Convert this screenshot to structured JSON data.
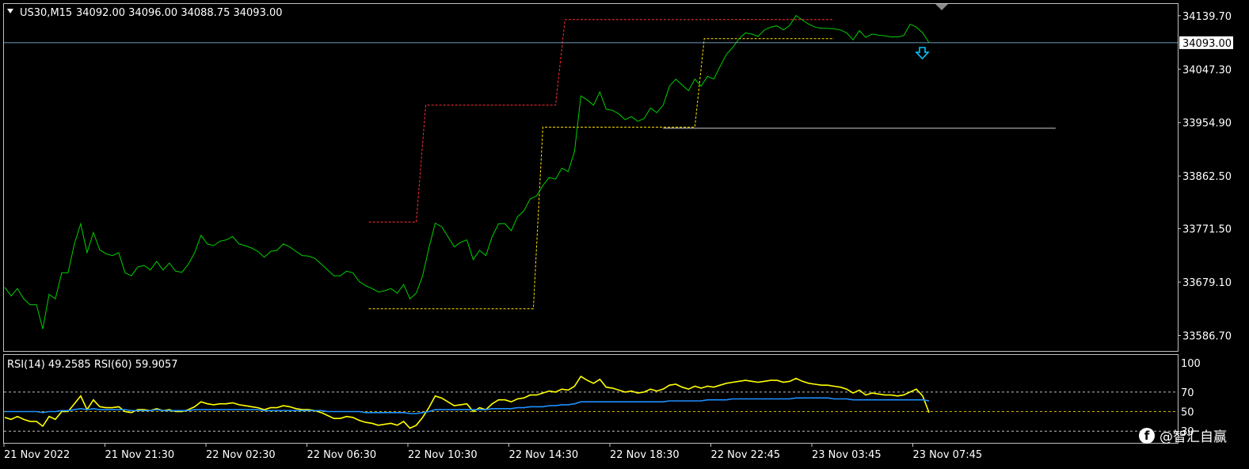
{
  "header": {
    "symbol": "US30,M15",
    "ohlc": "34092.00 34096.00 34088.75 34093.00"
  },
  "rsi_header": "RSI(14) 49.2585  RSI(60) 59.9057",
  "current_price_label": "34093.00",
  "watermark": {
    "text": "@智汇自赢",
    "icon": "facebook-icon"
  },
  "colors": {
    "background": "#000000",
    "price_line": "#00d000",
    "red_level": "#ff3030",
    "yellow_level": "#ffe000",
    "rsi14": "#ffff00",
    "rsi60": "#1e90ff",
    "marker": "#00c8ff"
  },
  "chart_data": [
    {
      "type": "line",
      "name": "price",
      "y_ticks": [
        "34139.70",
        "34047.30",
        "33954.90",
        "33862.50",
        "33771.50",
        "33679.10",
        "33586.70"
      ],
      "x_ticks": [
        "21 Nov 2022",
        "21 Nov 21:30",
        "22 Nov 02:30",
        "22 Nov 06:30",
        "22 Nov 10:30",
        "22 Nov 14:30",
        "22 Nov 18:30",
        "22 Nov 22:45",
        "23 Nov 03:45",
        "23 Nov 07:45"
      ],
      "ylim": [
        33560,
        34160
      ],
      "xlim": [
        0,
        147
      ],
      "series": [
        {
          "name": "price",
          "values": [
            33670,
            33655,
            33668,
            33650,
            33640,
            33640,
            33598,
            33658,
            33650,
            33695,
            33695,
            33745,
            33780,
            33730,
            33765,
            33735,
            33728,
            33725,
            33730,
            33695,
            33690,
            33705,
            33708,
            33700,
            33715,
            33700,
            33712,
            33698,
            33696,
            33710,
            33730,
            33760,
            33745,
            33742,
            33750,
            33752,
            33758,
            33745,
            33742,
            33738,
            33732,
            33722,
            33732,
            33734,
            33745,
            33740,
            33732,
            33725,
            33724,
            33720,
            33710,
            33700,
            33690,
            33690,
            33698,
            33695,
            33680,
            33673,
            33668,
            33662,
            33664,
            33668,
            33660,
            33675,
            33650,
            33660,
            33690,
            33738,
            33781,
            33775,
            33758,
            33740,
            33748,
            33752,
            33718,
            33734,
            33725,
            33758,
            33780,
            33780,
            33768,
            33792,
            33802,
            33823,
            33828,
            33846,
            33860,
            33857,
            33876,
            33870,
            33905,
            34001,
            33994,
            33985,
            34008,
            33978,
            33976,
            33970,
            33960,
            33965,
            33957,
            33962,
            33980,
            33972,
            33985,
            34018,
            34030,
            34020,
            34010,
            34030,
            34018,
            34035,
            34030,
            34052,
            34073,
            34085,
            34100,
            34110,
            34108,
            34104,
            34115,
            34120,
            34122,
            34115,
            34123,
            34140,
            34132,
            34125,
            34120,
            34118,
            34118,
            34117,
            34115,
            34110,
            34098,
            34114,
            34102,
            34108,
            34106,
            34105,
            34103,
            34103,
            34105,
            34125,
            34120,
            34110,
            34093
          ]
        }
      ],
      "levels": [
        {
          "name": "red-level",
          "points": [
            [
              57.5,
              33783
            ],
            [
              65,
              33783
            ],
            [
              66.5,
              33985
            ],
            [
              87,
              33985
            ],
            [
              88.5,
              34133
            ],
            [
              131,
              34133
            ]
          ]
        },
        {
          "name": "yellow-level",
          "points": [
            [
              57.5,
              33633
            ],
            [
              83.5,
              33633
            ],
            [
              85,
              33947
            ],
            [
              109,
              33947
            ],
            [
              110.5,
              34100
            ],
            [
              131,
              34100
            ]
          ]
        },
        {
          "name": "support-line",
          "points": [
            [
              104,
              33945
            ],
            [
              166,
              33945
            ]
          ]
        }
      ],
      "current_price": 34093.0
    },
    {
      "type": "line",
      "name": "rsi",
      "ylim": [
        18,
        108
      ],
      "y_ticks": [
        "100",
        "70",
        "50",
        "30"
      ],
      "levels": [
        70,
        50,
        30
      ],
      "series": [
        {
          "name": "RSI(14)",
          "values": [
            44,
            42,
            45,
            42,
            40,
            40,
            35,
            45,
            42,
            50,
            50,
            58,
            66,
            52,
            62,
            55,
            54,
            54,
            55,
            50,
            49,
            52,
            52,
            51,
            53,
            51,
            52,
            50,
            50,
            52,
            55,
            60,
            58,
            57,
            58,
            58,
            59,
            57,
            56,
            55,
            54,
            52,
            54,
            54,
            56,
            55,
            53,
            52,
            52,
            51,
            49,
            46,
            43,
            43,
            45,
            44,
            41,
            39,
            38,
            36,
            37,
            38,
            36,
            40,
            33,
            36,
            44,
            54,
            66,
            64,
            60,
            56,
            57,
            58,
            50,
            54,
            52,
            58,
            62,
            62,
            60,
            63,
            64,
            67,
            67,
            69,
            71,
            70,
            73,
            72,
            76,
            86,
            82,
            79,
            83,
            75,
            74,
            72,
            70,
            71,
            69,
            70,
            73,
            71,
            73,
            77,
            78,
            75,
            73,
            76,
            74,
            76,
            75,
            77,
            79,
            80,
            81,
            82,
            81,
            80,
            81,
            82,
            82,
            80,
            81,
            84,
            81,
            79,
            78,
            77,
            77,
            76,
            75,
            73,
            69,
            72,
            67,
            69,
            68,
            67,
            67,
            66,
            67,
            70,
            73,
            66,
            49
          ]
        },
        {
          "name": "RSI(60)",
          "values": [
            50,
            50,
            50,
            50,
            50,
            50,
            49,
            50,
            50,
            51,
            51,
            52,
            53,
            52,
            53,
            52,
            52,
            52,
            52,
            52,
            51,
            51,
            51,
            51,
            52,
            51,
            51,
            51,
            51,
            51,
            52,
            52,
            52,
            52,
            52,
            52,
            52,
            52,
            52,
            52,
            52,
            51,
            51,
            51,
            51,
            51,
            51,
            51,
            51,
            51,
            51,
            50,
            50,
            50,
            50,
            50,
            50,
            49,
            49,
            49,
            49,
            49,
            49,
            49,
            48,
            48,
            49,
            50,
            52,
            52,
            52,
            52,
            52,
            52,
            52,
            52,
            52,
            53,
            53,
            53,
            53,
            54,
            54,
            55,
            55,
            55,
            56,
            56,
            57,
            57,
            58,
            60,
            60,
            60,
            60,
            60,
            60,
            60,
            60,
            60,
            60,
            60,
            60,
            60,
            60,
            61,
            61,
            61,
            61,
            61,
            61,
            62,
            62,
            62,
            62,
            63,
            63,
            63,
            63,
            63,
            63,
            63,
            63,
            63,
            63,
            64,
            64,
            64,
            64,
            64,
            64,
            63,
            63,
            63,
            62,
            62,
            62,
            62,
            62,
            62,
            62,
            62,
            62,
            62,
            62,
            62,
            61
          ]
        }
      ]
    }
  ]
}
